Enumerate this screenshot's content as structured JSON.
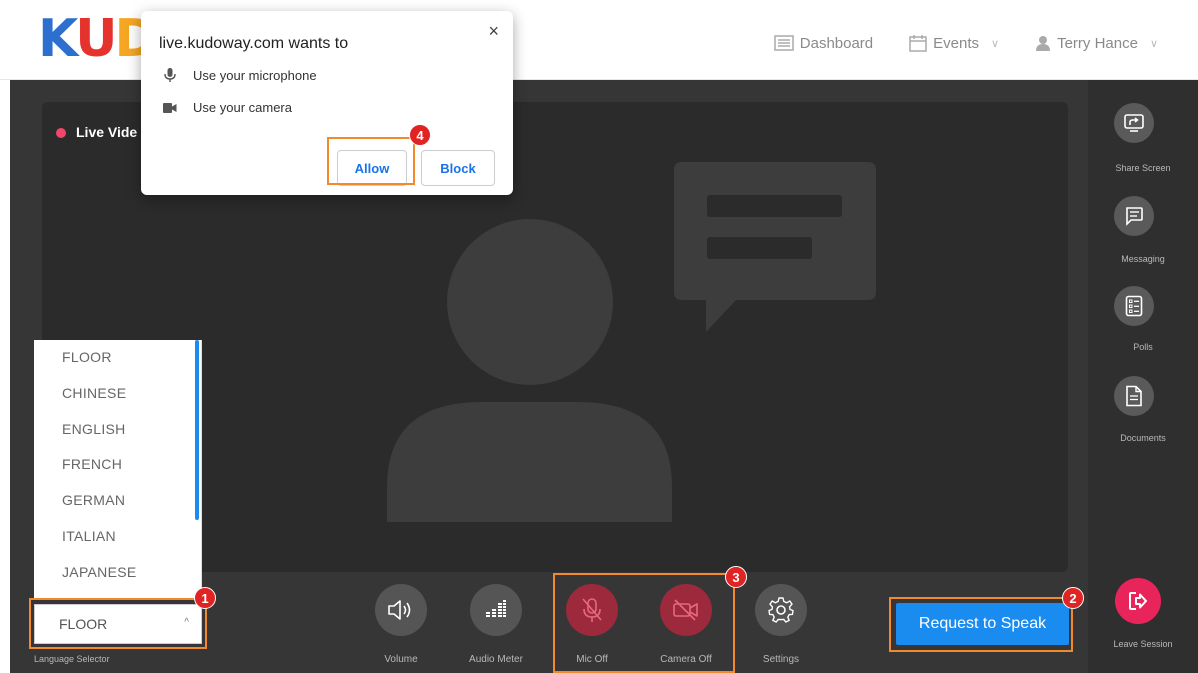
{
  "header": {
    "logo_letters": [
      "K",
      "U",
      "D"
    ],
    "nav": {
      "dashboard": "Dashboard",
      "events": "Events",
      "user": "Terry Hance"
    }
  },
  "video": {
    "live_label": "Live Vide"
  },
  "popup": {
    "title": "live.kudoway.com wants to",
    "microphone": "Use your microphone",
    "camera": "Use your camera",
    "allow": "Allow",
    "block": "Block",
    "close": "×"
  },
  "rail": {
    "share_screen": "Share Screen",
    "messaging": "Messaging",
    "polls": "Polls",
    "documents": "Documents",
    "leave_session": "Leave Session"
  },
  "controls": {
    "volume": "Volume",
    "audio_meter": "Audio Meter",
    "mic_off": "Mic Off",
    "camera_off": "Camera Off",
    "settings": "Settings",
    "request_to_speak": "Request to Speak"
  },
  "language": {
    "options": [
      "FLOOR",
      "CHINESE",
      "ENGLISH",
      "FRENCH",
      "GERMAN",
      "ITALIAN",
      "JAPANESE"
    ],
    "selected": "FLOOR",
    "label": "Language Selector"
  },
  "badges": {
    "one": "1",
    "two": "2",
    "three": "3",
    "four": "4"
  },
  "colors": {
    "accent_blue": "#1a8cf0",
    "highlight_orange": "#f28a2c",
    "badge_red": "#e02323",
    "leave_red": "#e8245a",
    "muted_red": "#9c2a3c"
  }
}
